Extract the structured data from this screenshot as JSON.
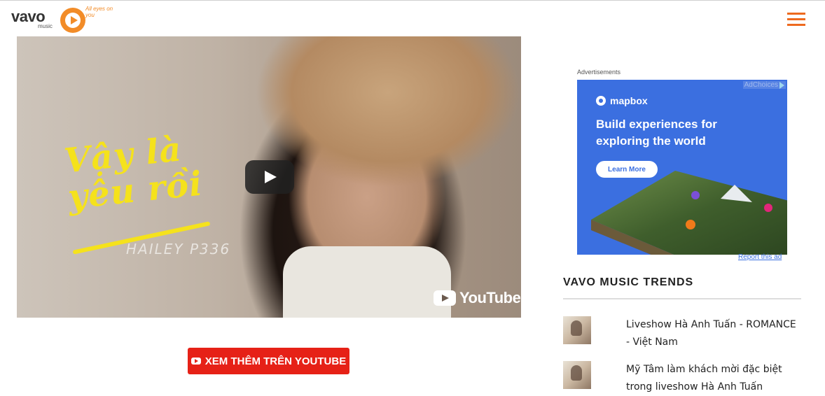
{
  "header": {
    "logo_word": "vavo",
    "logo_sub": "music",
    "logo_slogan": "All eyes on you",
    "menu_icon": "hamburger-menu-icon",
    "accent_color": "#ee6a1f"
  },
  "video": {
    "title_art": "Vậy là yêu rồi",
    "artist": "HAILEY P336",
    "player_brand": "YouTube",
    "play_icon": "play-icon"
  },
  "cta": {
    "label": "XEM THÊM TRÊN YOUTUBE",
    "color": "#e62117"
  },
  "ad": {
    "label": "Advertisements",
    "adchoices": "AdChoices",
    "brand": "mapbox",
    "headline": "Build experiences for exploring the world",
    "button": "Learn More",
    "report": "Report this ad",
    "background": "#3b6fe0"
  },
  "trends": {
    "title": "VAVO MUSIC TRENDS",
    "items": [
      {
        "text": "Liveshow Hà Anh Tuấn - ROMANCE - Việt Nam"
      },
      {
        "text": "Mỹ Tâm làm khách mời đặc biệt trong liveshow Hà Anh Tuấn"
      }
    ]
  }
}
